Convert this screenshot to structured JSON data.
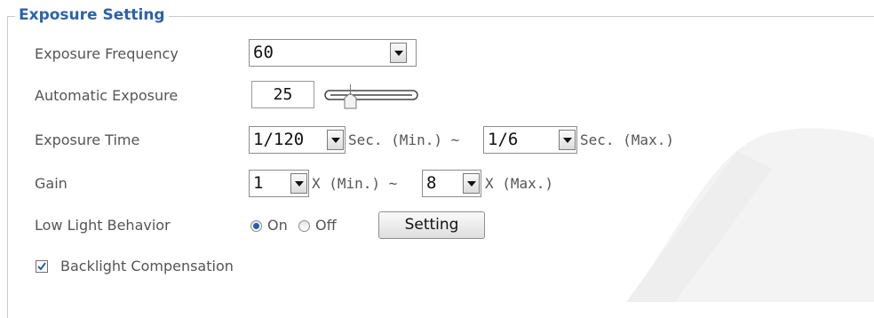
{
  "section": {
    "title": "Exposure Setting"
  },
  "exposure_frequency": {
    "label": "Exposure Frequency",
    "value": "60"
  },
  "automatic_exposure": {
    "label": "Automatic Exposure",
    "value": "25"
  },
  "exposure_time": {
    "label": "Exposure Time",
    "min_value": "1/120",
    "min_unit": "Sec.  (Min.) ~",
    "max_value": "1/6",
    "max_unit": "Sec.  (Max.)"
  },
  "gain": {
    "label": "Gain",
    "min_value": "1",
    "min_unit": "X  (Min.) ~",
    "max_value": "8",
    "max_unit": "X  (Max.)"
  },
  "low_light": {
    "label": "Low Light Behavior",
    "on_label": "On",
    "off_label": "Off",
    "selected": "On",
    "setting_button": "Setting"
  },
  "backlight": {
    "label": "Backlight Compensation",
    "checked": true
  },
  "colors": {
    "accent": "#2e62a8",
    "text": "#555555",
    "border": "#8d8d8d"
  },
  "icons": {
    "dropdown": "triangle-down-icon",
    "check": "checkmark-icon"
  }
}
